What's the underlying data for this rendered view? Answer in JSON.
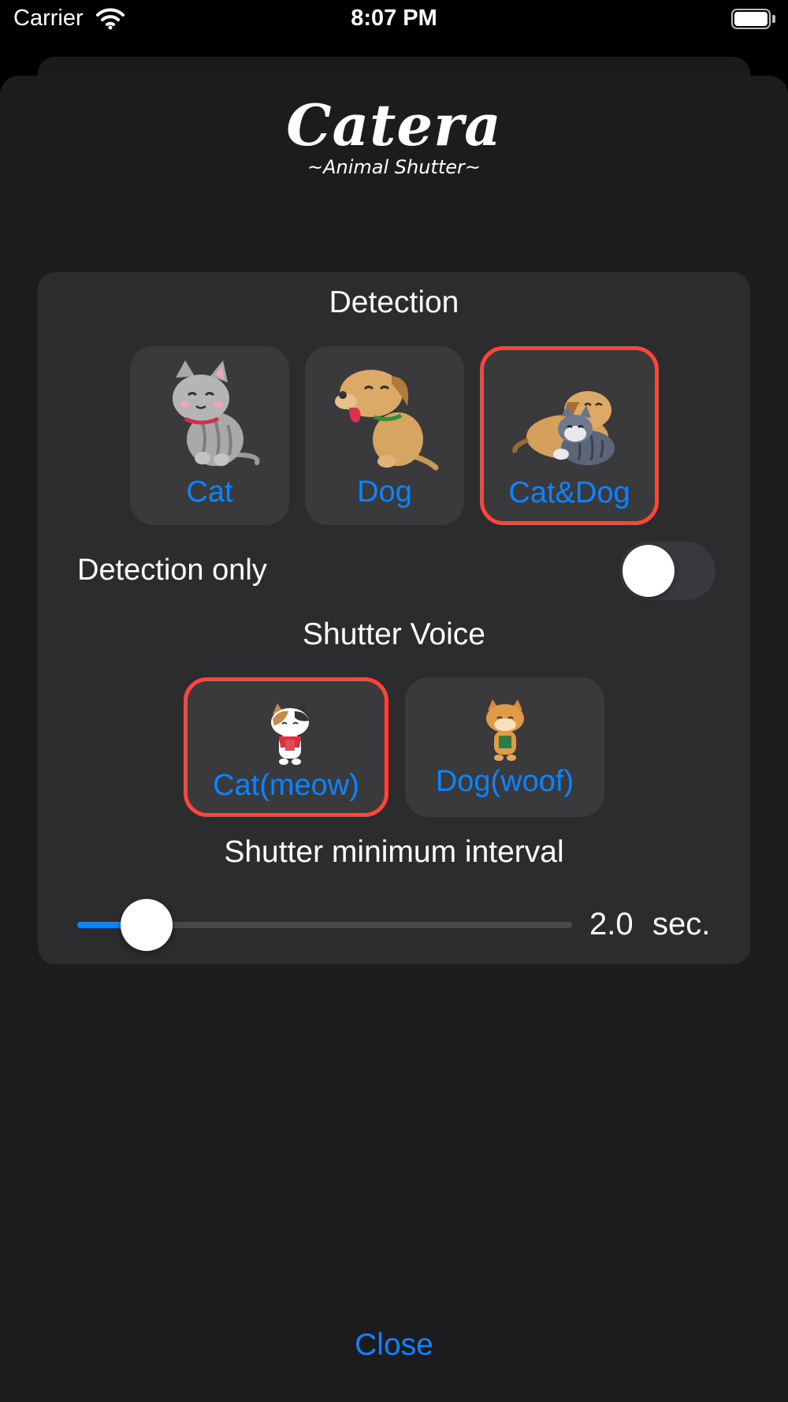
{
  "status_bar": {
    "carrier": "Carrier",
    "time": "8:07 PM"
  },
  "logo": {
    "title": "Catera",
    "subtitle": "~Animal Shutter~"
  },
  "detection": {
    "title": "Detection",
    "options": [
      {
        "label": "Cat",
        "icon": "cat-illustration",
        "selected": false
      },
      {
        "label": "Dog",
        "icon": "dog-illustration",
        "selected": false
      },
      {
        "label": "Cat&Dog",
        "icon": "cat-and-dog-illustration",
        "selected": true
      }
    ]
  },
  "detection_only": {
    "label": "Detection only",
    "on": false
  },
  "shutter_voice": {
    "title": "Shutter Voice",
    "options": [
      {
        "label": "Cat(meow)",
        "icon": "calico-cat-illustration",
        "selected": true
      },
      {
        "label": "Dog(woof)",
        "icon": "shiba-dog-illustration",
        "selected": false
      }
    ]
  },
  "interval": {
    "title": "Shutter minimum interval",
    "value": "2.0",
    "unit": "sec.",
    "slider_fraction": 0.14
  },
  "close_label": "Close",
  "colors": {
    "accent": "#0a84ff",
    "selected_border": "#ff453a",
    "panel": "#2c2c2e",
    "sheet": "#1c1c1e"
  }
}
